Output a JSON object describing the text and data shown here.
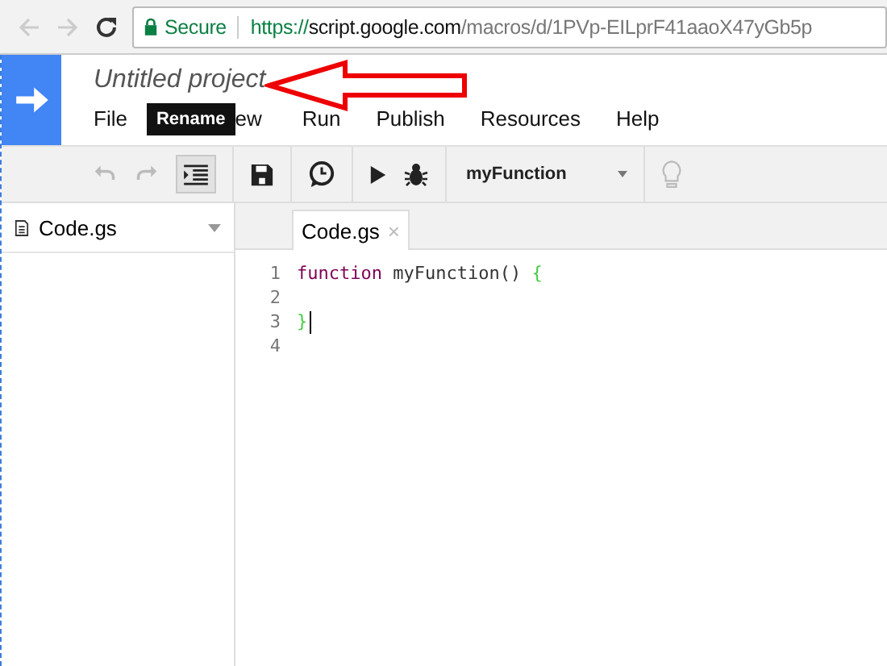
{
  "browser": {
    "back_disabled": true,
    "forward_disabled": true,
    "security": "Secure",
    "url": {
      "scheme": "https://",
      "host": "script.google.com",
      "path": "/macros/d/1PVp-EILprF41aaoX47yGb5p"
    }
  },
  "header": {
    "title": "Untitled project",
    "tooltip": "Rename",
    "menu": [
      "File",
      "ew",
      "Run",
      "Publish",
      "Resources",
      "Help"
    ]
  },
  "toolbar": {
    "undo_disabled": true,
    "redo_disabled": true,
    "indent_pressed": true,
    "function": "myFunction",
    "hint_disabled": true
  },
  "sidebar": {
    "files": [
      {
        "name": "Code.gs",
        "selected": false
      }
    ]
  },
  "tabs": [
    {
      "label": "Code.gs",
      "close": "×",
      "selected": true
    }
  ],
  "code": [
    {
      "number": "1",
      "tokens": [
        {
          "kind": "keyword",
          "text": "function"
        },
        {
          "kind": "plain",
          "text": " myFunction() "
        },
        {
          "kind": "brace",
          "text": "{"
        }
      ]
    },
    {
      "number": "2"
    },
    {
      "number": "3",
      "cursor": true,
      "tokens": [
        {
          "kind": "brace",
          "text": "}"
        }
      ]
    },
    {
      "number": "4"
    }
  ]
}
